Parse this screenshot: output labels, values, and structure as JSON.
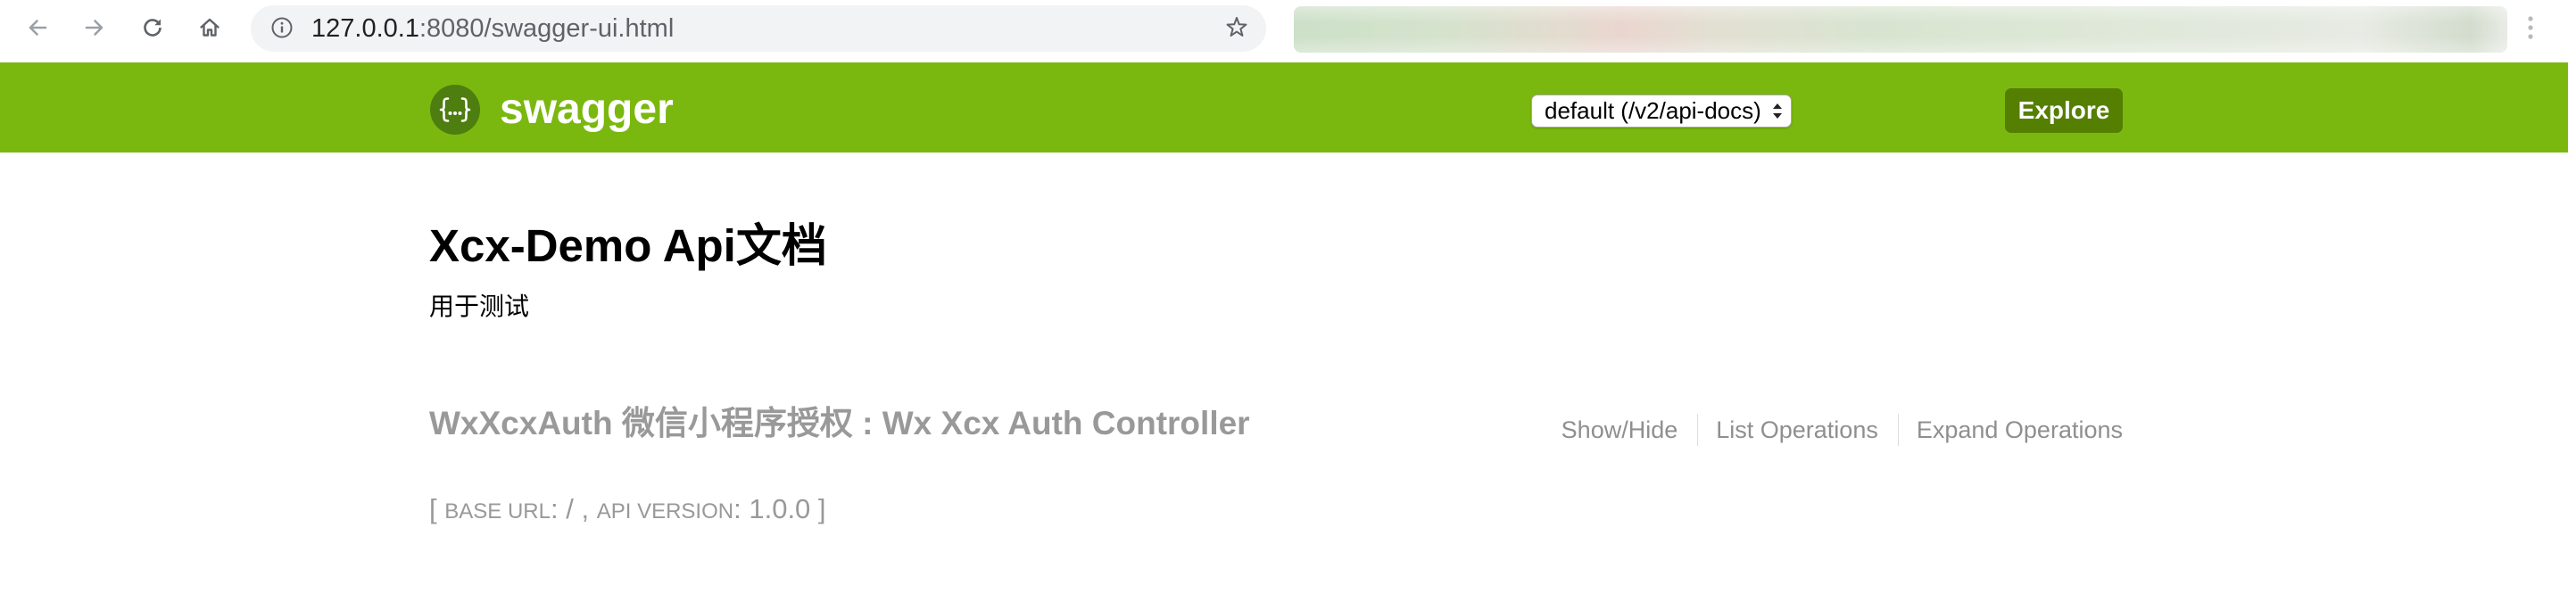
{
  "browser": {
    "url_host": "127.0.0.1",
    "url_rest": ":8080/swagger-ui.html",
    "toolbar_icons": [
      "arrow-left-icon",
      "arrow-right-icon",
      "reload-icon",
      "home-icon",
      "info-icon",
      "star-icon",
      "more-vert-icon"
    ]
  },
  "header": {
    "logo_icon": "swagger-logo-icon",
    "logo_text": "swagger",
    "api_selector": {
      "selected": "default (/v2/api-docs)",
      "icon": "updown-arrows-icon"
    },
    "explore_label": "Explore"
  },
  "info": {
    "title": "Xcx-Demo Api文档",
    "description": "用于测试"
  },
  "resources": [
    {
      "name": "WxXcxAuth 微信小程序授权",
      "separator": ":",
      "summary": "Wx Xcx Auth Controller",
      "options": [
        "Show/Hide",
        "List Operations",
        "Expand Operations"
      ]
    }
  ],
  "footer": {
    "open_bracket": "[",
    "base_url_label": "BASE URL",
    "label_separator": ":",
    "base_url": "/",
    "item_separator": ",",
    "api_version_label": "API VERSION",
    "api_version": "1.0.0",
    "close_bracket": "]"
  },
  "colors": {
    "header_background": "#7ab80f",
    "explore_button": "#547f00",
    "omnibox_background": "#f1f3f4",
    "muted_text": "#999999"
  }
}
